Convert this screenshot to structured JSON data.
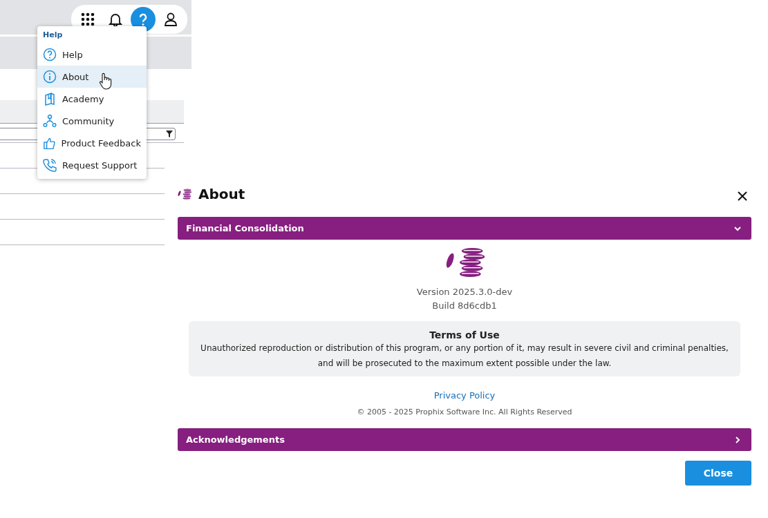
{
  "toolbar": [
    {
      "kind": "apps",
      "selected": false
    },
    {
      "kind": "bell",
      "selected": false
    },
    {
      "kind": "help",
      "selected": true
    },
    {
      "kind": "user",
      "selected": false
    }
  ],
  "help_menu": {
    "heading": "Help",
    "items": [
      {
        "kind": "help",
        "label": "Help",
        "selected": false
      },
      {
        "kind": "info",
        "label": "About",
        "selected": true
      },
      {
        "kind": "book",
        "label": "Academy",
        "selected": false
      },
      {
        "kind": "people",
        "label": "Community",
        "selected": false
      },
      {
        "kind": "thumb",
        "label": "Product Feedback",
        "selected": false
      },
      {
        "kind": "phone",
        "label": "Request Support",
        "selected": false
      }
    ]
  },
  "dialog": {
    "title": "About",
    "sections": [
      {
        "title": "Financial Consolidation",
        "expanded": true
      },
      {
        "title": "Acknowledgements",
        "expanded": false
      }
    ],
    "version": "Version 2025.3.0-dev",
    "build": "Build 8d6cdb1",
    "terms": {
      "title": "Terms of Use",
      "text": "Unauthorized reproduction or distribution of this program, or any portion of it, may result in severe civil and criminal penalties, and will be prosecuted to the maximum extent possible under the law."
    },
    "privacy_link": "Privacy Policy",
    "copyright": "© 2005 - 2025 Prophix Software Inc. All Rights Reserved",
    "close_button": "Close"
  }
}
